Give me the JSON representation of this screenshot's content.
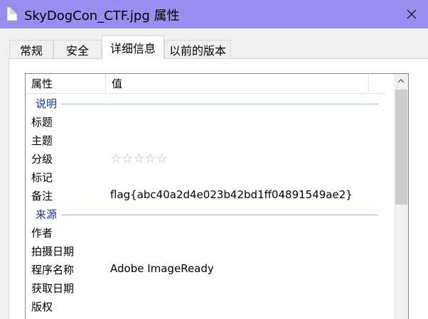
{
  "window": {
    "title": "SkyDogCon_CTF.jpg 属性",
    "file_icon": "file-icon",
    "close_icon": "close-icon"
  },
  "tabs": [
    {
      "label": "常规",
      "active": false
    },
    {
      "label": "安全",
      "active": false
    },
    {
      "label": "详细信息",
      "active": true
    },
    {
      "label": "以前的版本",
      "active": false
    }
  ],
  "table": {
    "headers": {
      "property": "属性",
      "value": "值"
    },
    "groups": [
      {
        "label": "说明",
        "rows": [
          {
            "name": "标题",
            "value": ""
          },
          {
            "name": "主题",
            "value": ""
          },
          {
            "name": "分级",
            "value": "☆☆☆☆☆",
            "rating": 0,
            "max_rating": 5
          },
          {
            "name": "标记",
            "value": ""
          },
          {
            "name": "备注",
            "value": "flag{abc40a2d4e023b42bd1ff04891549ae2}"
          }
        ]
      },
      {
        "label": "来源",
        "rows": [
          {
            "name": "作者",
            "value": ""
          },
          {
            "name": "拍摄日期",
            "value": ""
          },
          {
            "name": "程序名称",
            "value": "Adobe ImageReady"
          },
          {
            "name": "获取日期",
            "value": ""
          },
          {
            "name": "版权",
            "value": ""
          }
        ]
      }
    ]
  },
  "colors": {
    "titlebar": "#9a8ff0",
    "group_label": "#1e3287",
    "group_line": "#a3b4d8"
  }
}
